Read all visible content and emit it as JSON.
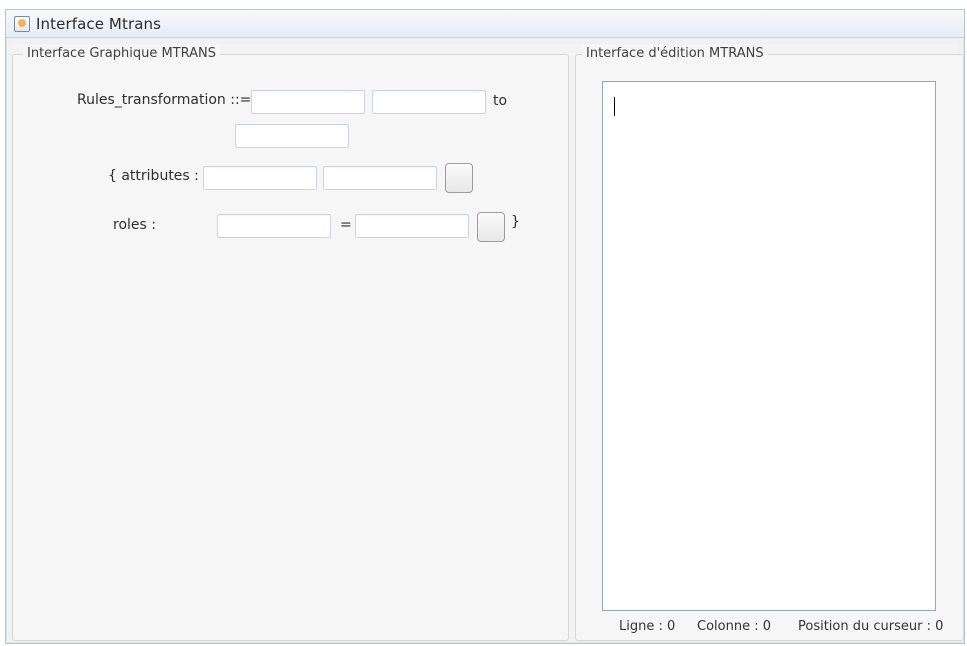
{
  "window": {
    "title": "Interface Mtrans",
    "icon": "java-app-icon"
  },
  "left_panel": {
    "title": "Interface Graphique MTRANS",
    "rules_label": "Rules_transformation ::=",
    "to_label": "to",
    "attributes_label": "{ attributes :",
    "roles_label": "roles :",
    "equals_label": "=",
    "close_brace": "}"
  },
  "right_panel": {
    "title": "Interface d'édition MTRANS",
    "editor_text": "",
    "status": {
      "line": "Ligne : 0",
      "column": "Colonne : 0",
      "cursor_position": "Position du curseur : 0"
    }
  },
  "colors": {
    "window_border": "#b9c4d3",
    "field_border": "#c9d5e5",
    "editor_border": "#8fa9ad",
    "panel_background": "#f6f6f6"
  }
}
